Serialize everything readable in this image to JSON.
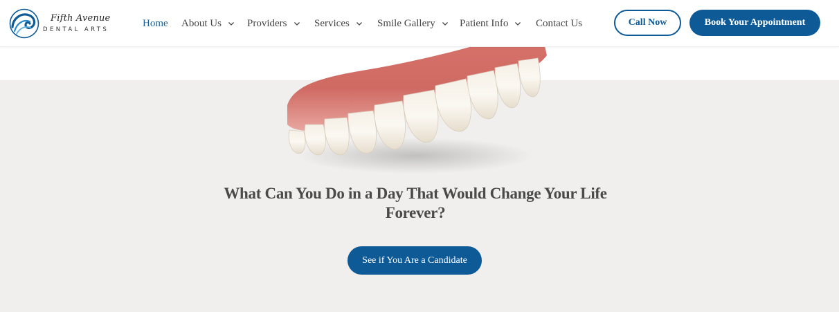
{
  "brand": {
    "name_script": "Fifth Avenue",
    "name_sub": "DENTAL ARTS",
    "logo_icon": "wave-logo-icon",
    "accent": "#0d5a97"
  },
  "nav": {
    "items": [
      {
        "label": "Home",
        "active": true,
        "dropdown": false
      },
      {
        "label": "About Us",
        "active": false,
        "dropdown": true
      },
      {
        "label": "Providers",
        "active": false,
        "dropdown": true
      },
      {
        "label": "Services",
        "active": false,
        "dropdown": true
      },
      {
        "label": "Smile Gallery",
        "active": false,
        "dropdown": true
      },
      {
        "label": "Patient Info",
        "active": false,
        "dropdown": true
      },
      {
        "label": "Contact Us",
        "active": false,
        "dropdown": false
      }
    ],
    "chevron_icon": "chevron-down-icon"
  },
  "actions": {
    "call_label": "Call Now",
    "book_label": "Book Your Appointment"
  },
  "hero": {
    "image": "denture-arch-image",
    "headline": "What Can You Do in a Day That Would Change Your Life Forever?",
    "cta_label": "See if You Are a Candidate",
    "background": "#f0efed"
  }
}
